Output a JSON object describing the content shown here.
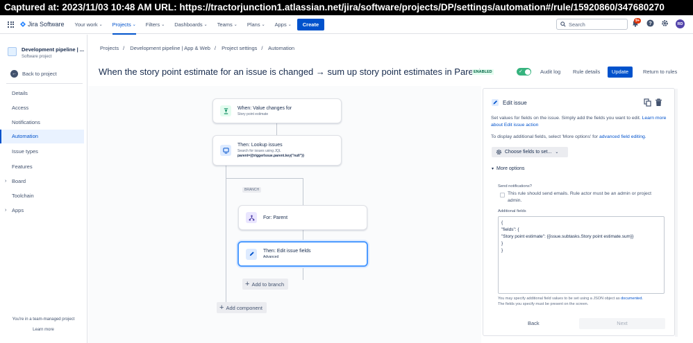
{
  "capture": {
    "text": "Captured at: 2023/11/03 10:48 AM    URL: https://tractorjunction1.atlassian.net/jira/software/projects/DP/settings/automation#/rule/15920860/347680270"
  },
  "topnav": {
    "product": "Jira Software",
    "items": [
      {
        "label": "Your work",
        "active": false
      },
      {
        "label": "Projects",
        "active": true
      },
      {
        "label": "Filters",
        "active": false
      },
      {
        "label": "Dashboards",
        "active": false
      },
      {
        "label": "Teams",
        "active": false
      },
      {
        "label": "Plans",
        "active": false
      },
      {
        "label": "Apps",
        "active": false
      }
    ],
    "create_label": "Create",
    "search_placeholder": "Search",
    "notifications_badge": "9+",
    "avatar_initials": "RD"
  },
  "sidebar": {
    "project_name": "Development pipeline | ...",
    "project_type": "Software project",
    "back_label": "Back to project",
    "items": [
      {
        "label": "Details"
      },
      {
        "label": "Access"
      },
      {
        "label": "Notifications"
      },
      {
        "label": "Automation"
      },
      {
        "label": "Issue types"
      },
      {
        "label": "Features"
      },
      {
        "label": "Board"
      },
      {
        "label": "Toolchain"
      },
      {
        "label": "Apps"
      }
    ],
    "footer_text": "You're in a team-managed project",
    "learn_more": "Learn more"
  },
  "breadcrumbs": [
    "Projects",
    "Development pipeline | App & Web",
    "Project settings",
    "Automation"
  ],
  "rule": {
    "title": "When the story point estimate for an issue is changed → sum up story point estimates in Parent",
    "status": "ENABLED",
    "audit_log": "Audit log",
    "rule_details": "Rule details",
    "update": "Update",
    "return": "Return to rules"
  },
  "flow": {
    "trigger": {
      "title": "When: Value changes for",
      "sub": "Story point estimate"
    },
    "lookup": {
      "title": "Then: Lookup issues",
      "sub": "Search for issues using JQL",
      "jql": "parent={{triggerIssue.parent.key|\"null\"}}"
    },
    "branch_tag": "BRANCH",
    "for_parent": {
      "title": "For: Parent"
    },
    "edit": {
      "title": "Then: Edit issue fields",
      "sub": "Advanced"
    },
    "add_to_branch": "Add to branch",
    "add_component": "Add component"
  },
  "panel": {
    "title": "Edit issue",
    "desc_text": "Set values for fields on the issue. Simply add the fields you want to edit.",
    "desc_link": "Learn more about Edit issue action",
    "display_text": "To display additional fields, select 'More options' for",
    "display_link": "advanced field editing.",
    "choose_fields": "Choose fields to set...",
    "more_options": "More options",
    "send_notifications_label": "Send notifications?",
    "send_notifications_text": "This rule should send emails. Rule actor must be an admin or project admin.",
    "additional_fields_label": "Additional fields",
    "additional_fields_value": "{\n\"fields\": {\n\"Story point estimate\": {{issue.subtasks.Story point estimate.sum}}\n}\n}",
    "note_text": "You may specify additional field values to be set using a JSON object as",
    "note_link": "documented.",
    "note_text2": "The fields you specify must be present on the screen.",
    "back": "Back",
    "next": "Next"
  },
  "colors": {
    "accent": "#0052cc",
    "enabled_green": "#36b37e",
    "selected_border": "#4c9aff"
  }
}
